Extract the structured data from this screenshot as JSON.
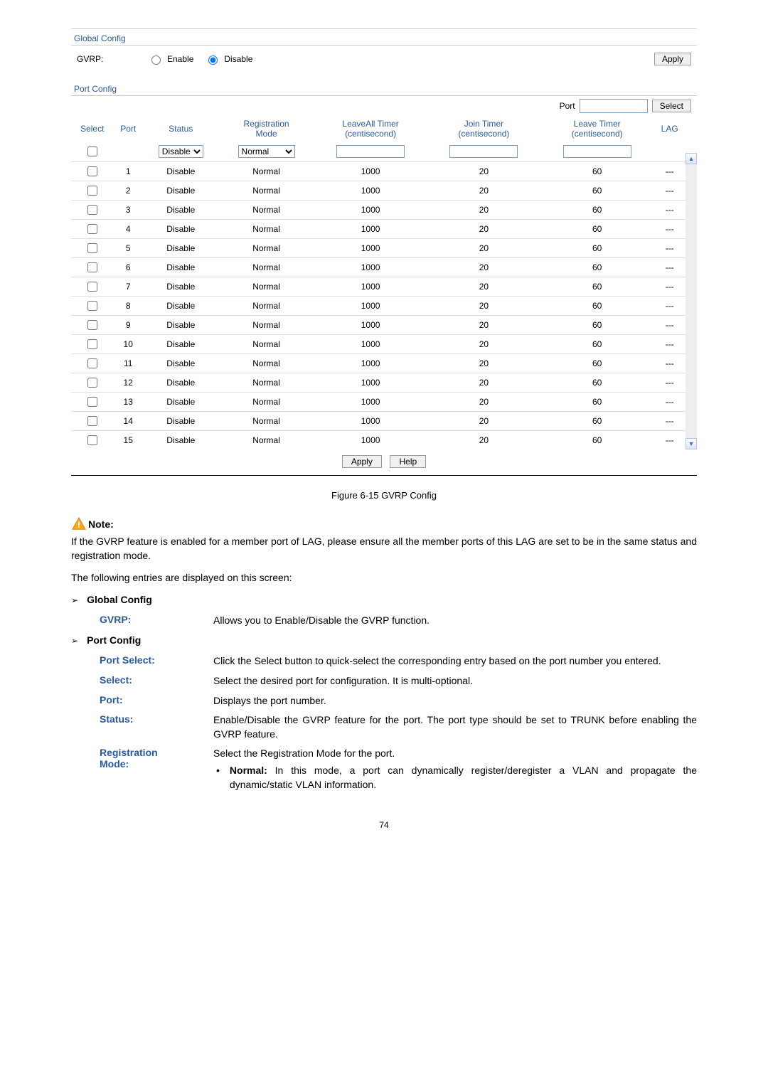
{
  "globalConfig": {
    "heading": "Global Config",
    "label": "GVRP:",
    "enable": "Enable",
    "disable": "Disable",
    "apply": "Apply"
  },
  "portConfig": {
    "heading": "Port Config",
    "portLabel": "Port",
    "selectBtn": "Select"
  },
  "columns": {
    "select": "Select",
    "port": "Port",
    "status": "Status",
    "regMode1": "Registration",
    "regMode2": "Mode",
    "leaveAll1": "LeaveAll Timer",
    "leaveAll2": "(centisecond)",
    "join1": "Join Timer",
    "join2": "(centisecond)",
    "leave1": "Leave Timer",
    "leave2": "(centisecond)",
    "lag": "LAG"
  },
  "filterOptions": {
    "status": "Disable",
    "mode": "Normal"
  },
  "rows": [
    {
      "port": "1",
      "status": "Disable",
      "mode": "Normal",
      "leaveAll": "1000",
      "join": "20",
      "leave": "60",
      "lag": "---"
    },
    {
      "port": "2",
      "status": "Disable",
      "mode": "Normal",
      "leaveAll": "1000",
      "join": "20",
      "leave": "60",
      "lag": "---"
    },
    {
      "port": "3",
      "status": "Disable",
      "mode": "Normal",
      "leaveAll": "1000",
      "join": "20",
      "leave": "60",
      "lag": "---"
    },
    {
      "port": "4",
      "status": "Disable",
      "mode": "Normal",
      "leaveAll": "1000",
      "join": "20",
      "leave": "60",
      "lag": "---"
    },
    {
      "port": "5",
      "status": "Disable",
      "mode": "Normal",
      "leaveAll": "1000",
      "join": "20",
      "leave": "60",
      "lag": "---"
    },
    {
      "port": "6",
      "status": "Disable",
      "mode": "Normal",
      "leaveAll": "1000",
      "join": "20",
      "leave": "60",
      "lag": "---"
    },
    {
      "port": "7",
      "status": "Disable",
      "mode": "Normal",
      "leaveAll": "1000",
      "join": "20",
      "leave": "60",
      "lag": "---"
    },
    {
      "port": "8",
      "status": "Disable",
      "mode": "Normal",
      "leaveAll": "1000",
      "join": "20",
      "leave": "60",
      "lag": "---"
    },
    {
      "port": "9",
      "status": "Disable",
      "mode": "Normal",
      "leaveAll": "1000",
      "join": "20",
      "leave": "60",
      "lag": "---"
    },
    {
      "port": "10",
      "status": "Disable",
      "mode": "Normal",
      "leaveAll": "1000",
      "join": "20",
      "leave": "60",
      "lag": "---"
    },
    {
      "port": "11",
      "status": "Disable",
      "mode": "Normal",
      "leaveAll": "1000",
      "join": "20",
      "leave": "60",
      "lag": "---"
    },
    {
      "port": "12",
      "status": "Disable",
      "mode": "Normal",
      "leaveAll": "1000",
      "join": "20",
      "leave": "60",
      "lag": "---"
    },
    {
      "port": "13",
      "status": "Disable",
      "mode": "Normal",
      "leaveAll": "1000",
      "join": "20",
      "leave": "60",
      "lag": "---"
    },
    {
      "port": "14",
      "status": "Disable",
      "mode": "Normal",
      "leaveAll": "1000",
      "join": "20",
      "leave": "60",
      "lag": "---"
    },
    {
      "port": "15",
      "status": "Disable",
      "mode": "Normal",
      "leaveAll": "1000",
      "join": "20",
      "leave": "60",
      "lag": "---"
    }
  ],
  "bottomButtons": {
    "apply": "Apply",
    "help": "Help"
  },
  "figureCaption": "Figure 6-15 GVRP Config",
  "noteLabel": "Note:",
  "noteText": "If the GVRP feature is enabled for a member port of LAG, please ensure all the member ports of this LAG are set to be in the same status and registration mode.",
  "introText": "The following entries are displayed on this screen:",
  "section1": "Global Config",
  "gvrpDesc": {
    "label": "GVRP:",
    "text": "Allows you to Enable/Disable the GVRP function."
  },
  "section2": "Port Config",
  "portSelectDesc": {
    "label": "Port Select:",
    "text": "Click the Select button to quick-select the corresponding entry based on the port number you entered."
  },
  "selectDesc": {
    "label": "Select:",
    "text": "Select the desired port for configuration. It is multi-optional."
  },
  "portDesc": {
    "label": "Port:",
    "text": "Displays the port number."
  },
  "statusDesc": {
    "label": "Status:",
    "text": "Enable/Disable the GVRP feature for the port. The port type should be set to TRUNK before enabling the GVRP feature."
  },
  "regModeDesc": {
    "label1": "Registration",
    "label2": "Mode:",
    "text": "Select the Registration Mode for the port.",
    "bulletBold": "Normal:",
    "bulletText": " In this mode, a port can dynamically register/deregister a VLAN and propagate the dynamic/static VLAN information."
  },
  "pageNum": "74"
}
